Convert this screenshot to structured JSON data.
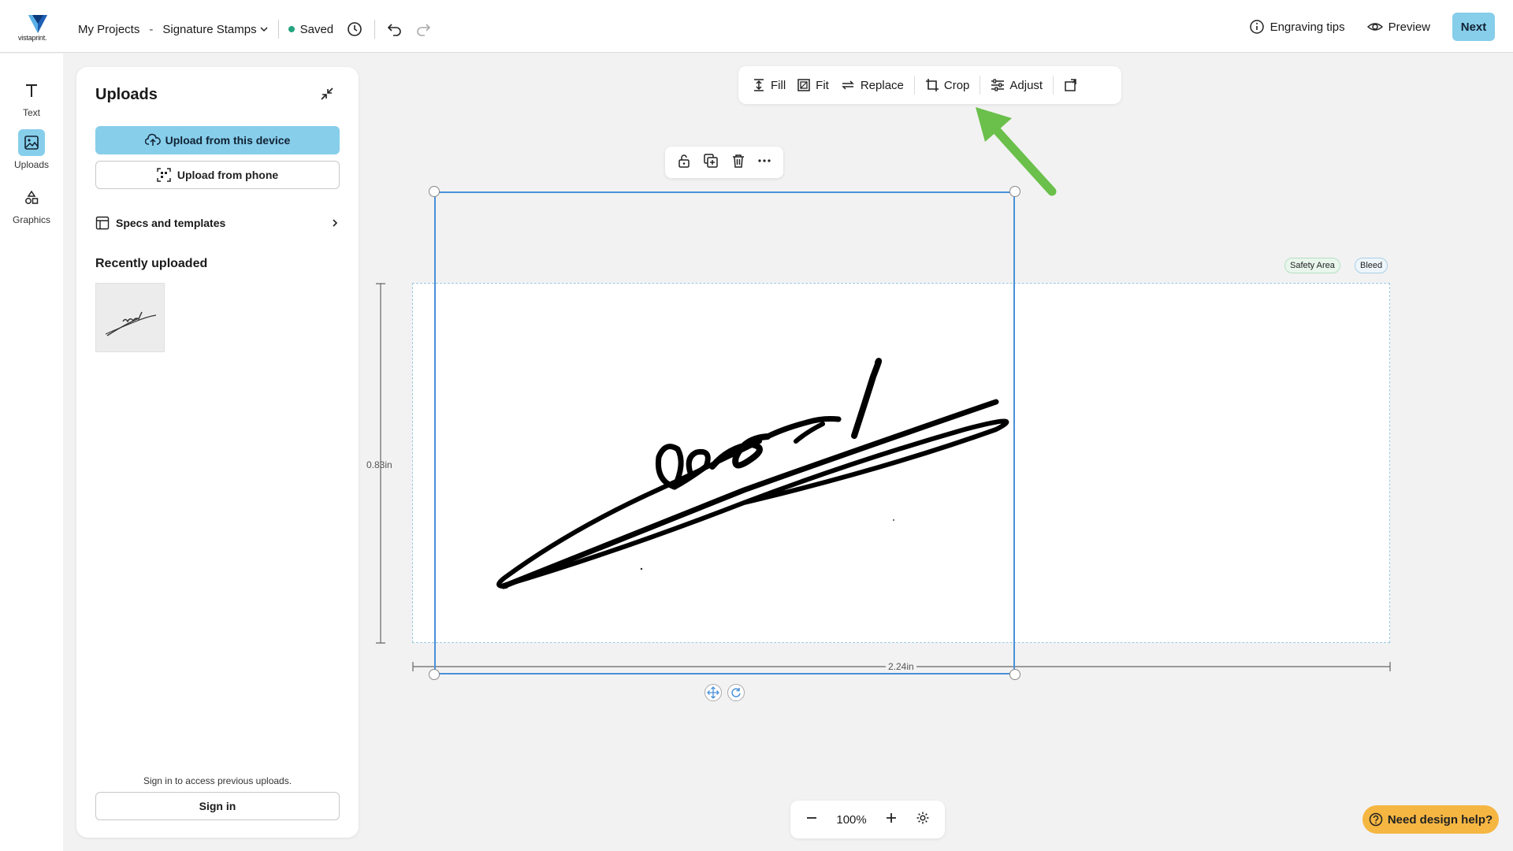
{
  "header": {
    "logo_text": "vistaprint.",
    "breadcrumb_root": "My Projects",
    "breadcrumb_separator": "-",
    "project_name": "Signature Stamps",
    "saved_label": "Saved",
    "engraving_tips": "Engraving tips",
    "preview": "Preview",
    "next": "Next"
  },
  "rail": {
    "items": [
      {
        "label": "Text",
        "icon": "text-icon"
      },
      {
        "label": "Uploads",
        "icon": "image-icon",
        "active": true
      },
      {
        "label": "Graphics",
        "icon": "shapes-icon"
      }
    ]
  },
  "panel": {
    "title": "Uploads",
    "upload_device": "Upload from this device",
    "upload_phone": "Upload from phone",
    "specs": "Specs and templates",
    "recent_title": "Recently uploaded",
    "signin_note": "Sign in to access previous uploads.",
    "signin": "Sign in"
  },
  "toolbar": {
    "fill": "Fill",
    "fit": "Fit",
    "replace": "Replace",
    "crop": "Crop",
    "adjust": "Adjust"
  },
  "canvas": {
    "safety_area": "Safety Area",
    "bleed": "Bleed",
    "height_label": "0.83in",
    "width_label": "2.24in"
  },
  "zoom": {
    "level": "100%"
  },
  "help": {
    "label": "Need design help?"
  },
  "colors": {
    "accent": "#87ceeb",
    "selection": "#4a90d9",
    "saved_dot": "#24a47f",
    "arrow": "#6ac04a",
    "help": "#f5b642"
  }
}
